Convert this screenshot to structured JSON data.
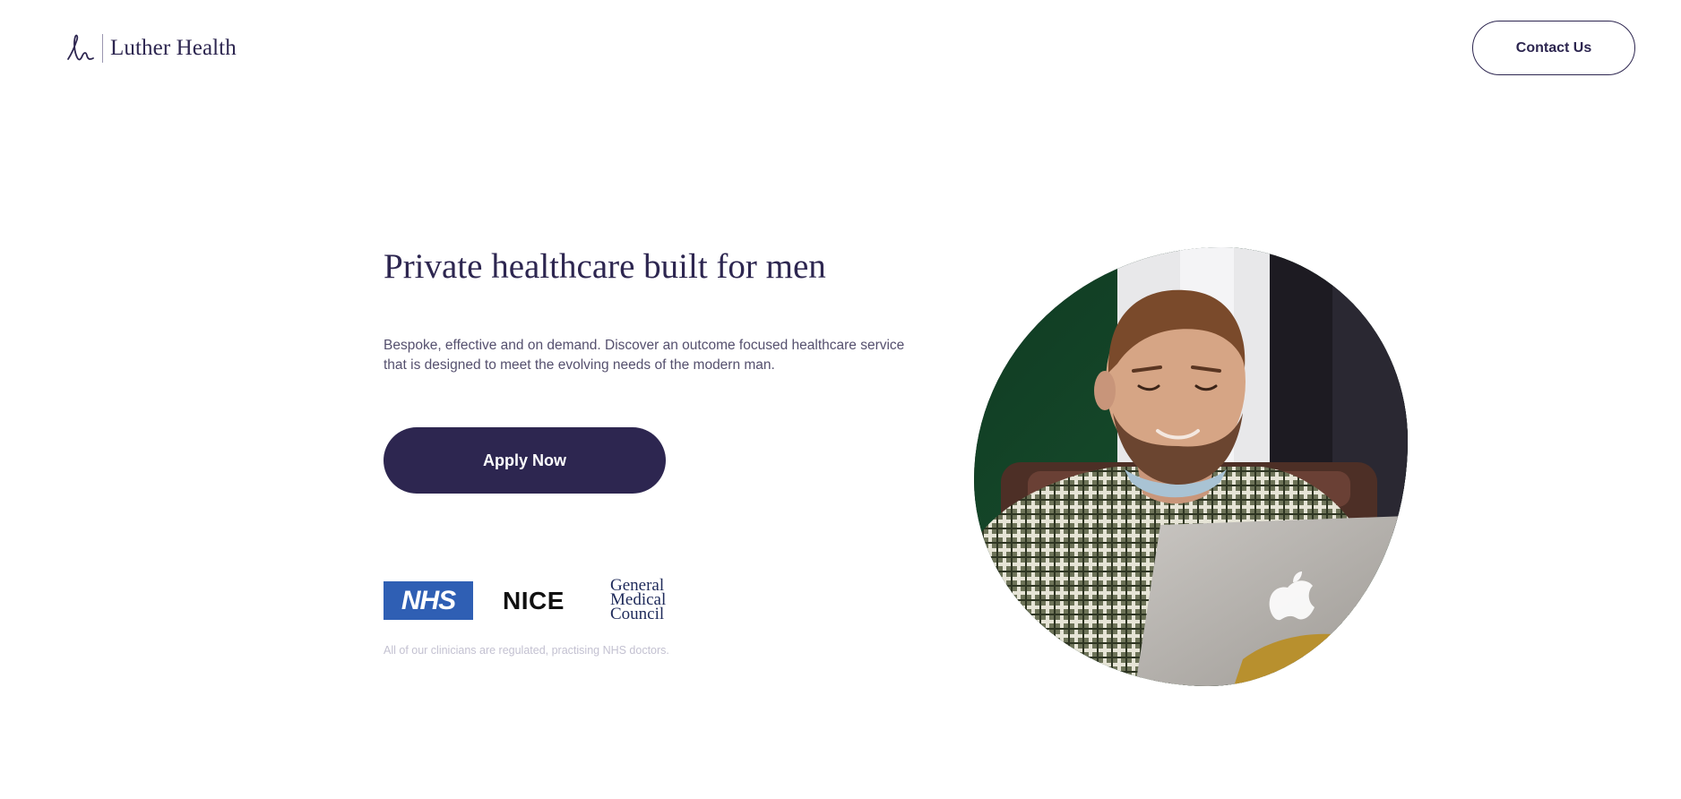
{
  "header": {
    "logo_text": "Luther Health",
    "logo_icon": "signature-l-icon",
    "contact_label": "Contact Us"
  },
  "hero": {
    "title": "Private healthcare built for men",
    "description": "Bespoke, effective and on demand. Discover an outcome focused healthcare service that is designed to meet the evolving needs of the modern man.",
    "apply_label": "Apply Now",
    "image_icon": "man-with-laptop-photo"
  },
  "accreditations": {
    "nhs_label": "NHS",
    "nice_label": "NICE",
    "gmc_lines": [
      "General",
      "Medical",
      "Council"
    ],
    "note": "All of our clinicians are regulated, practising NHS doctors."
  },
  "colors": {
    "brand_navy": "#2d2650",
    "nhs_blue": "#2f5fb4",
    "note_gray": "#c3c1d1",
    "background": "#ffffff"
  }
}
